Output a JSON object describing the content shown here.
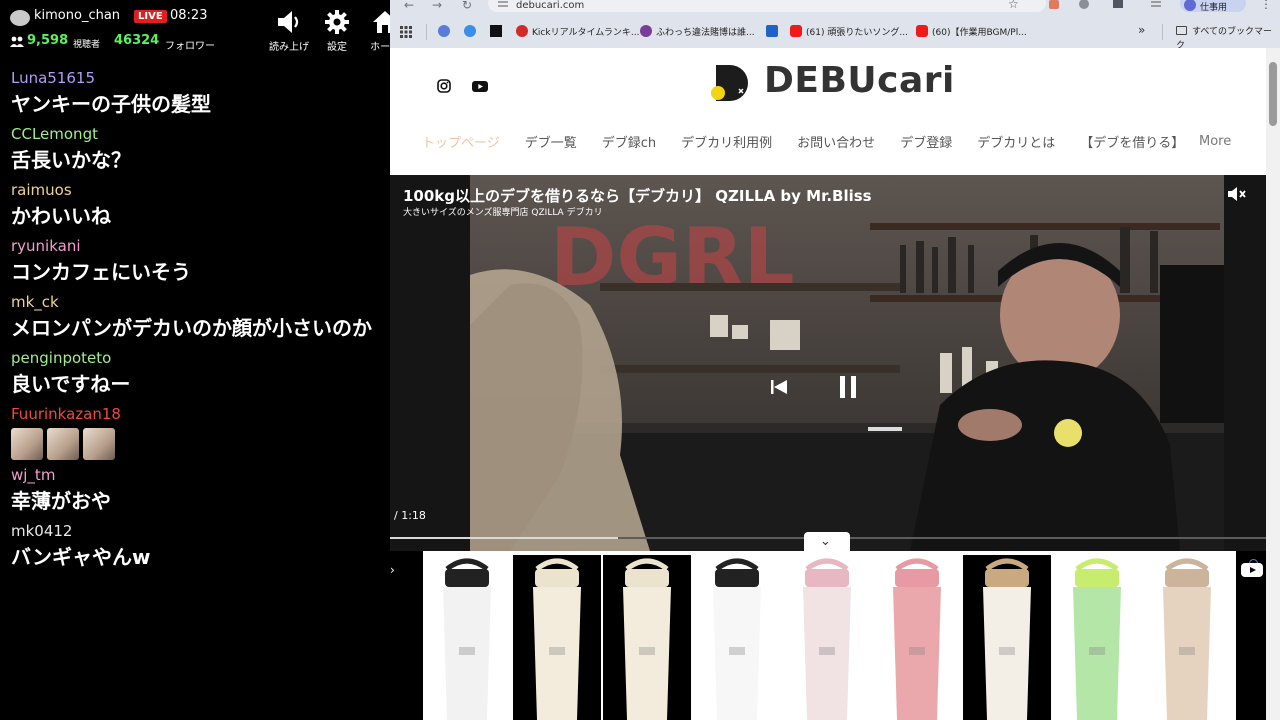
{
  "chat": {
    "header": {
      "streamer": "kimono_chan",
      "live_label": "LIVE",
      "time": "08:23",
      "viewers": "9,598",
      "viewers_label": "視聴者",
      "followers": "46324",
      "followers_label": "フォロワー",
      "buttons": [
        {
          "label": "読み上げ",
          "icon": "speaker-icon"
        },
        {
          "label": "設定",
          "icon": "gear-icon"
        },
        {
          "label": "ホーム",
          "icon": "home-icon"
        }
      ]
    },
    "messages": [
      {
        "user": "Luna51615",
        "color": "#b59cf6",
        "text": "ヤンキーの子供の髪型"
      },
      {
        "user": "CCLemongt",
        "color": "#9ff08c",
        "text": "舌長いかな？"
      },
      {
        "user": "raimuos",
        "color": "#f2d48a",
        "text": "かわいいね"
      },
      {
        "user": "ryunikani",
        "color": "#f29ed0",
        "text": "コンカフェにいそう"
      },
      {
        "user": "mk_ck",
        "color": "#f2d48a",
        "text": "メロンパンがデカいのか顔が小さいのか"
      },
      {
        "user": "penginpoteto",
        "color": "#9ff08c",
        "text": "良いですねー"
      },
      {
        "user": "Fuurinkazan18",
        "color": "#ef4a3a",
        "text": "",
        "stickers": 3
      },
      {
        "user": "wj_tm",
        "color": "#f29ed0",
        "text": "幸薄がおや"
      },
      {
        "user": "mk0412",
        "color": "#e8e8e8",
        "text": "バンギャやんw"
      }
    ]
  },
  "browser": {
    "url": "debucari.com",
    "profile_label": "仕事用",
    "bookmarks": [
      {
        "label": "",
        "icon_color": "#5a7bd8"
      },
      {
        "label": "",
        "icon_color": "#3a8ee6"
      },
      {
        "label": "",
        "icon_color": "#111111"
      },
      {
        "label": "Kickリアルタイムランキ...",
        "icon_color": "#d22a2a"
      },
      {
        "label": "ふわっち違法賭博は誰...",
        "icon_color": "#7a3d9a"
      },
      {
        "label": "",
        "icon_color": "#1f63c9"
      },
      {
        "label": "(61) 頑張りたいソング...",
        "icon_color": "#ee1b1b"
      },
      {
        "label": "(60)【作業用BGM/Pl...",
        "icon_color": "#ee1b1b"
      }
    ],
    "all_bookmarks": "すべてのブックマーク",
    "site": {
      "logo_text": "DEBUcari",
      "nav": [
        "トップページ",
        "デブ一覧",
        "デブ録ch",
        "デブカリ利用例",
        "お問い合わせ",
        "デブ登録",
        "デブカリとは",
        "【デブを借りる】"
      ],
      "nav_more": "More",
      "video": {
        "title": "100kg以上のデブを借りるなら【デブカリ】 QZILLA by Mr.Bliss",
        "subtitle": "大きいサイズのメンズ服専門店 QZILLA デブカリ",
        "time": "/ 1:18",
        "progress": 0.26
      }
    },
    "ad": {
      "products": [
        {
          "body": "#f2f2f2",
          "cap": "#222222",
          "dark": false
        },
        {
          "body": "#f3ecdc",
          "cap": "#ece3cf",
          "dark": true
        },
        {
          "body": "#f3ecdc",
          "cap": "#ece3cf",
          "dark": true
        },
        {
          "body": "#f7f7f7",
          "cap": "#222222",
          "dark": false
        },
        {
          "body": "#f1e2e4",
          "cap": "#e7b7c2",
          "dark": false
        },
        {
          "body": "#eba8ac",
          "cap": "#e79aa3",
          "dark": false
        },
        {
          "body": "#f4efe6",
          "cap": "#c9a980",
          "dark": true
        },
        {
          "body": "#b4e6a7",
          "cap": "#c8ec6e",
          "dark": false
        },
        {
          "body": "#e6d3bf",
          "cap": "#cbb49b",
          "dark": false
        }
      ]
    }
  }
}
